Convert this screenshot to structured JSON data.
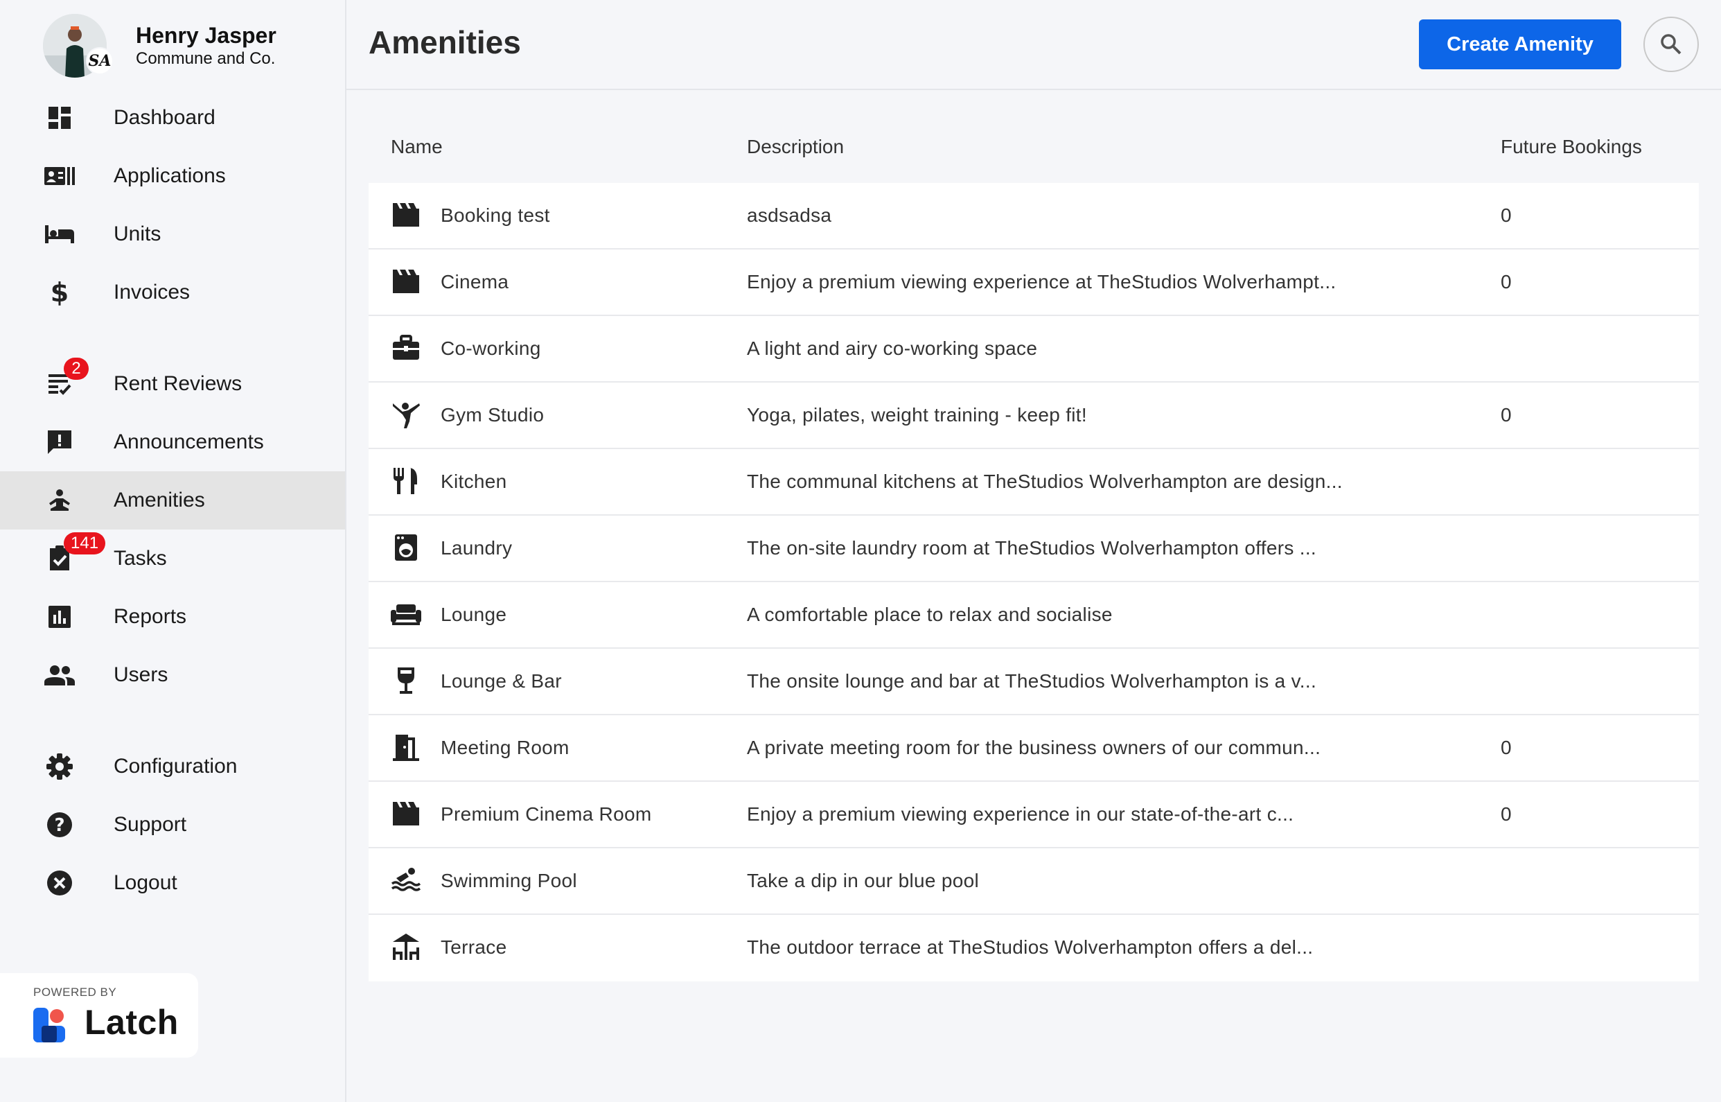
{
  "user": {
    "name": "Henry Jasper",
    "company": "Commune and Co.",
    "org_initials": "SA"
  },
  "nav": {
    "items": [
      {
        "id": "dashboard",
        "label": "Dashboard",
        "icon": "dashboard-icon"
      },
      {
        "id": "applications",
        "label": "Applications",
        "icon": "contacts-icon"
      },
      {
        "id": "units",
        "label": "Units",
        "icon": "bed-icon"
      },
      {
        "id": "invoices",
        "label": "Invoices",
        "icon": "dollar-icon"
      },
      {
        "id": "rent-reviews",
        "label": "Rent Reviews",
        "icon": "checklist-icon",
        "badge": "2"
      },
      {
        "id": "announcements",
        "label": "Announcements",
        "icon": "announcement-icon"
      },
      {
        "id": "amenities",
        "label": "Amenities",
        "icon": "amenity-icon",
        "active": true
      },
      {
        "id": "tasks",
        "label": "Tasks",
        "icon": "task-icon",
        "badge": "141"
      },
      {
        "id": "reports",
        "label": "Reports",
        "icon": "bar-chart-icon"
      },
      {
        "id": "users",
        "label": "Users",
        "icon": "people-icon"
      },
      {
        "id": "configuration",
        "label": "Configuration",
        "icon": "gear-icon"
      },
      {
        "id": "support",
        "label": "Support",
        "icon": "help-icon"
      },
      {
        "id": "logout",
        "label": "Logout",
        "icon": "close-circle-icon"
      }
    ]
  },
  "branding": {
    "powered_by": "POWERED BY",
    "name": "Latch"
  },
  "header": {
    "title": "Amenities",
    "create_label": "Create Amenity"
  },
  "table": {
    "columns": {
      "name": "Name",
      "description": "Description",
      "future_bookings": "Future Bookings"
    },
    "rows": [
      {
        "icon": "clapperboard-icon",
        "name": "Booking test",
        "description": "asdsadsa",
        "future_bookings": "0"
      },
      {
        "icon": "clapperboard-icon",
        "name": "Cinema",
        "description": "Enjoy a premium viewing experience at TheStudios Wolverhampt...",
        "future_bookings": "0"
      },
      {
        "icon": "briefcase-icon",
        "name": "Co-working",
        "description": "A light and airy co-working space",
        "future_bookings": ""
      },
      {
        "icon": "gymnastics-icon",
        "name": "Gym Studio",
        "description": "Yoga, pilates, weight training - keep fit!",
        "future_bookings": "0"
      },
      {
        "icon": "cutlery-icon",
        "name": "Kitchen",
        "description": "The communal kitchens at TheStudios Wolverhampton are design...",
        "future_bookings": ""
      },
      {
        "icon": "washing-machine-icon",
        "name": "Laundry",
        "description": "The on-site laundry room at TheStudios Wolverhampton offers ...",
        "future_bookings": ""
      },
      {
        "icon": "sofa-icon",
        "name": "Lounge",
        "description": "A comfortable place to relax and socialise",
        "future_bookings": ""
      },
      {
        "icon": "wine-glass-icon",
        "name": "Lounge & Bar",
        "description": "The onsite lounge and bar at TheStudios Wolverhampton is a v...",
        "future_bookings": ""
      },
      {
        "icon": "door-icon",
        "name": "Meeting Room",
        "description": "A private meeting room for the business owners of our commun...",
        "future_bookings": "0"
      },
      {
        "icon": "clapperboard-icon",
        "name": "Premium Cinema Room",
        "description": "Enjoy a premium viewing experience in our state-of-the-art c...",
        "future_bookings": "0"
      },
      {
        "icon": "pool-icon",
        "name": "Swimming Pool",
        "description": "Take a dip in our blue pool",
        "future_bookings": ""
      },
      {
        "icon": "deck-icon",
        "name": "Terrace",
        "description": "The outdoor terrace at TheStudios Wolverhampton offers a del...",
        "future_bookings": ""
      }
    ]
  },
  "colors": {
    "accent": "#0d66e8",
    "badge": "#e8141d",
    "active_nav": "#e4e4e4",
    "background": "#f5f6f9"
  }
}
